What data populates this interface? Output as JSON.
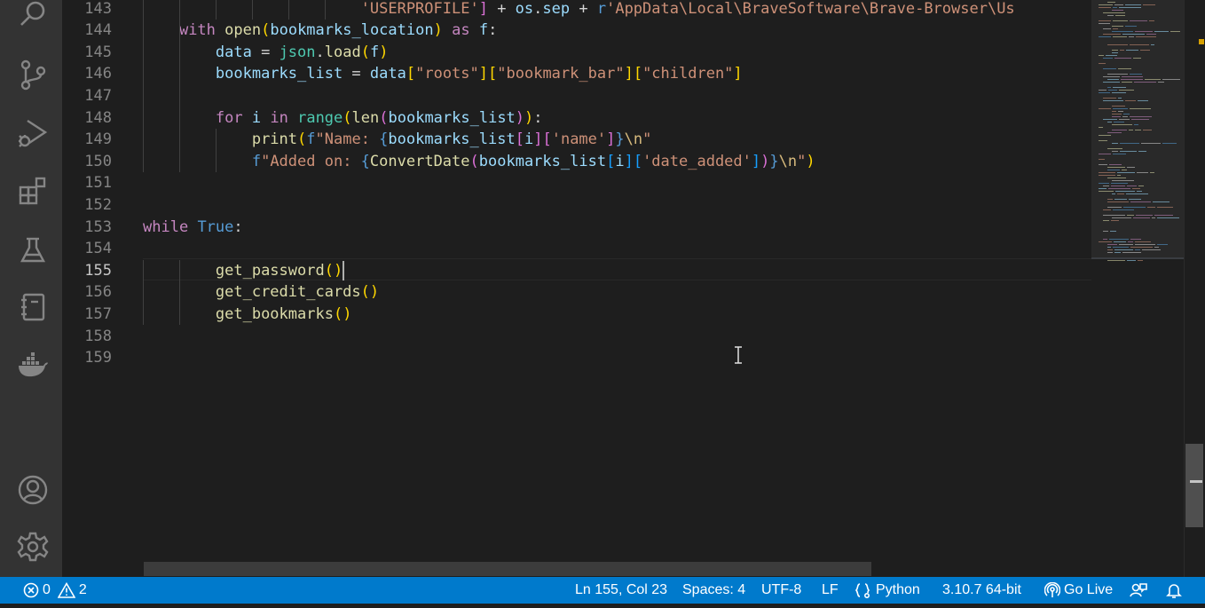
{
  "activity_bar": {
    "items": [
      {
        "icon": "search-icon"
      },
      {
        "icon": "source-control-icon"
      },
      {
        "icon": "run-debug-icon"
      },
      {
        "icon": "extensions-icon"
      },
      {
        "icon": "testing-icon"
      },
      {
        "icon": "notebook-icon"
      },
      {
        "icon": "docker-icon"
      }
    ],
    "bottom_items": [
      {
        "icon": "account-icon"
      },
      {
        "icon": "settings-gear-icon"
      }
    ]
  },
  "editor": {
    "active_line": "155",
    "lines": [
      {
        "num": "143",
        "tokens": [
          {
            "t": "                        ",
            "c": ""
          },
          {
            "t": "'USERPROFILE'",
            "c": "str"
          },
          {
            "t": "]",
            "c": "b2"
          },
          {
            "t": " + ",
            "c": ""
          },
          {
            "t": "os",
            "c": "var"
          },
          {
            "t": ".",
            "c": ""
          },
          {
            "t": "sep",
            "c": "var"
          },
          {
            "t": " + ",
            "c": ""
          },
          {
            "t": "r",
            "c": "const"
          },
          {
            "t": "'AppData\\Local\\BraveSoftware\\Brave-Browser\\Us",
            "c": "str"
          }
        ]
      },
      {
        "num": "144",
        "tokens": [
          {
            "t": "    ",
            "c": ""
          },
          {
            "t": "with",
            "c": "kw"
          },
          {
            "t": " ",
            "c": ""
          },
          {
            "t": "open",
            "c": "fn"
          },
          {
            "t": "(",
            "c": "b1"
          },
          {
            "t": "bookmarks_location",
            "c": "var"
          },
          {
            "t": ")",
            "c": "b1"
          },
          {
            "t": " ",
            "c": ""
          },
          {
            "t": "as",
            "c": "kw"
          },
          {
            "t": " ",
            "c": ""
          },
          {
            "t": "f",
            "c": "var"
          },
          {
            "t": ":",
            "c": ""
          }
        ]
      },
      {
        "num": "145",
        "tokens": [
          {
            "t": "        ",
            "c": ""
          },
          {
            "t": "data",
            "c": "var"
          },
          {
            "t": " = ",
            "c": ""
          },
          {
            "t": "json",
            "c": "cls"
          },
          {
            "t": ".",
            "c": ""
          },
          {
            "t": "load",
            "c": "fn"
          },
          {
            "t": "(",
            "c": "b1"
          },
          {
            "t": "f",
            "c": "var"
          },
          {
            "t": ")",
            "c": "b1"
          }
        ]
      },
      {
        "num": "146",
        "tokens": [
          {
            "t": "        ",
            "c": ""
          },
          {
            "t": "bookmarks_list",
            "c": "var"
          },
          {
            "t": " = ",
            "c": ""
          },
          {
            "t": "data",
            "c": "var"
          },
          {
            "t": "[",
            "c": "b1"
          },
          {
            "t": "\"roots\"",
            "c": "str"
          },
          {
            "t": "]",
            "c": "b1"
          },
          {
            "t": "[",
            "c": "b1"
          },
          {
            "t": "\"bookmark_bar\"",
            "c": "str"
          },
          {
            "t": "]",
            "c": "b1"
          },
          {
            "t": "[",
            "c": "b1"
          },
          {
            "t": "\"children\"",
            "c": "str"
          },
          {
            "t": "]",
            "c": "b1"
          }
        ]
      },
      {
        "num": "147",
        "tokens": []
      },
      {
        "num": "148",
        "tokens": [
          {
            "t": "        ",
            "c": ""
          },
          {
            "t": "for",
            "c": "kw"
          },
          {
            "t": " ",
            "c": ""
          },
          {
            "t": "i",
            "c": "var"
          },
          {
            "t": " ",
            "c": ""
          },
          {
            "t": "in",
            "c": "kw"
          },
          {
            "t": " ",
            "c": ""
          },
          {
            "t": "range",
            "c": "cls"
          },
          {
            "t": "(",
            "c": "b1"
          },
          {
            "t": "len",
            "c": "fn"
          },
          {
            "t": "(",
            "c": "b2"
          },
          {
            "t": "bookmarks_list",
            "c": "var"
          },
          {
            "t": ")",
            "c": "b2"
          },
          {
            "t": ")",
            "c": "b1"
          },
          {
            "t": ":",
            "c": ""
          }
        ]
      },
      {
        "num": "149",
        "tokens": [
          {
            "t": "            ",
            "c": ""
          },
          {
            "t": "print",
            "c": "fn"
          },
          {
            "t": "(",
            "c": "b1"
          },
          {
            "t": "f",
            "c": "const"
          },
          {
            "t": "\"Name: ",
            "c": "str"
          },
          {
            "t": "{",
            "c": "const"
          },
          {
            "t": "bookmarks_list",
            "c": "var"
          },
          {
            "t": "[",
            "c": "b2"
          },
          {
            "t": "i",
            "c": "var"
          },
          {
            "t": "]",
            "c": "b2"
          },
          {
            "t": "[",
            "c": "b2"
          },
          {
            "t": "'name'",
            "c": "str"
          },
          {
            "t": "]",
            "c": "b2"
          },
          {
            "t": "}",
            "c": "const"
          },
          {
            "t": "\\n",
            "c": "esc"
          },
          {
            "t": "\"",
            "c": "str"
          }
        ]
      },
      {
        "num": "150",
        "tokens": [
          {
            "t": "            ",
            "c": ""
          },
          {
            "t": "f",
            "c": "const"
          },
          {
            "t": "\"Added on: ",
            "c": "str"
          },
          {
            "t": "{",
            "c": "const"
          },
          {
            "t": "ConvertDate",
            "c": "fn"
          },
          {
            "t": "(",
            "c": "b2"
          },
          {
            "t": "bookmarks_list",
            "c": "var"
          },
          {
            "t": "[",
            "c": "b3"
          },
          {
            "t": "i",
            "c": "var"
          },
          {
            "t": "]",
            "c": "b3"
          },
          {
            "t": "[",
            "c": "b3"
          },
          {
            "t": "'date_added'",
            "c": "str"
          },
          {
            "t": "]",
            "c": "b3"
          },
          {
            "t": ")",
            "c": "b2"
          },
          {
            "t": "}",
            "c": "const"
          },
          {
            "t": "\\n",
            "c": "esc"
          },
          {
            "t": "\"",
            "c": "str"
          },
          {
            "t": ")",
            "c": "b1"
          }
        ]
      },
      {
        "num": "151",
        "tokens": []
      },
      {
        "num": "152",
        "tokens": []
      },
      {
        "num": "153",
        "tokens": [
          {
            "t": "while",
            "c": "kw"
          },
          {
            "t": " ",
            "c": ""
          },
          {
            "t": "True",
            "c": "const"
          },
          {
            "t": ":",
            "c": ""
          }
        ]
      },
      {
        "num": "154",
        "tokens": []
      },
      {
        "num": "155",
        "tokens": [
          {
            "t": "        ",
            "c": ""
          },
          {
            "t": "get_password",
            "c": "fn"
          },
          {
            "t": "(",
            "c": "b1"
          },
          {
            "t": ")",
            "c": "b1"
          }
        ]
      },
      {
        "num": "156",
        "tokens": [
          {
            "t": "        ",
            "c": ""
          },
          {
            "t": "get_credit_cards",
            "c": "fn"
          },
          {
            "t": "(",
            "c": "b1"
          },
          {
            "t": ")",
            "c": "b1"
          }
        ]
      },
      {
        "num": "157",
        "tokens": [
          {
            "t": "        ",
            "c": ""
          },
          {
            "t": "get_bookmarks",
            "c": "fn"
          },
          {
            "t": "(",
            "c": "b1"
          },
          {
            "t": ")",
            "c": "b1"
          }
        ]
      },
      {
        "num": "158",
        "tokens": []
      },
      {
        "num": "159",
        "tokens": []
      }
    ]
  },
  "status_bar": {
    "errors": "0",
    "warnings": "2",
    "cursor_position": "Ln 155, Col 23",
    "indentation": "Spaces: 4",
    "encoding": "UTF-8",
    "line_ending": "LF",
    "language": "Python",
    "interpreter": "3.10.7 64-bit",
    "go_live": "Go Live",
    "background_color": "#007acc"
  }
}
